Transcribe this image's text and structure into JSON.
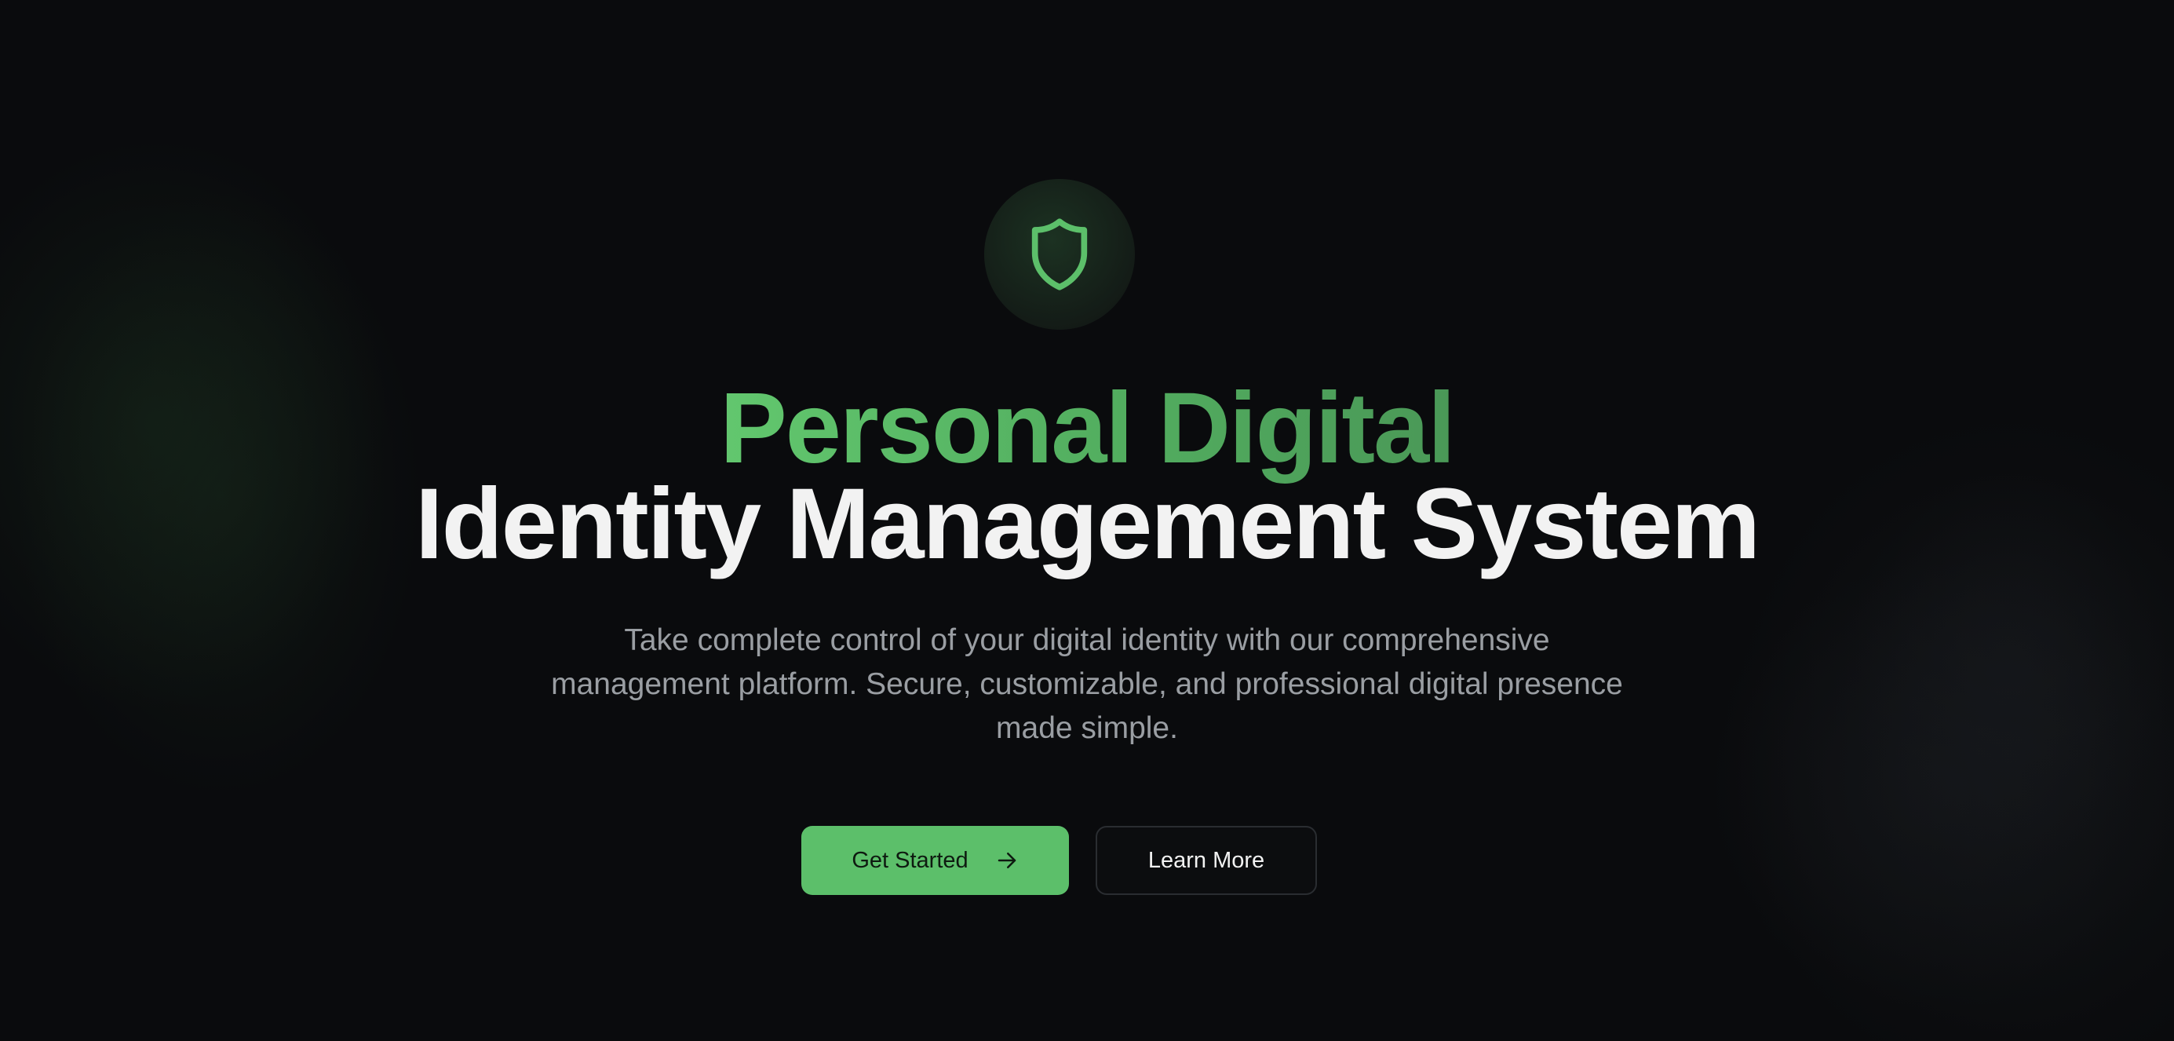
{
  "hero": {
    "icon": "shield-icon",
    "title_line1": "Personal Digital",
    "title_line2": "Identity Management System",
    "subtitle": "Take complete control of your digital identity with our comprehensive management platform. Secure, customizable, and professional digital presence made simple.",
    "primary_button": "Get Started",
    "primary_button_icon": "arrow-right-icon",
    "secondary_button": "Learn More"
  },
  "colors": {
    "accent": "#5cbf6a",
    "background": "#0a0b0d",
    "title_text": "#f2f2f2",
    "subtitle_text": "#9a9ea3"
  }
}
